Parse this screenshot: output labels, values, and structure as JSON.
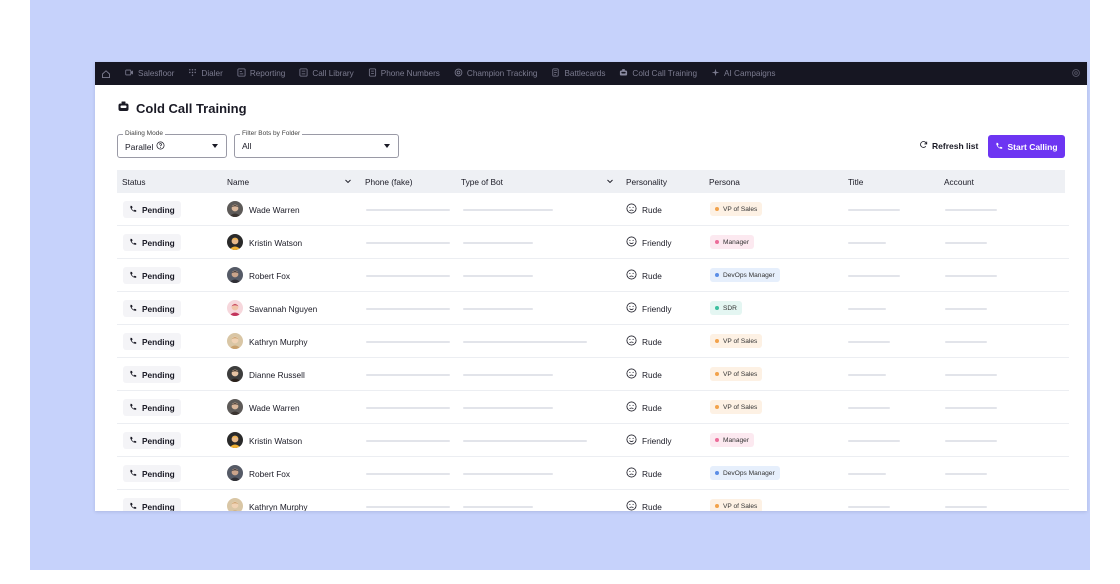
{
  "nav": {
    "items": [
      {
        "label": "Salesfloor",
        "icon": "video-icon"
      },
      {
        "label": "Dialer",
        "icon": "dialpad-icon"
      },
      {
        "label": "Reporting",
        "icon": "report-icon"
      },
      {
        "label": "Call Library",
        "icon": "library-icon"
      },
      {
        "label": "Phone Numbers",
        "icon": "phone-numbers-icon"
      },
      {
        "label": "Champion Tracking",
        "icon": "target-icon"
      },
      {
        "label": "Battlecards",
        "icon": "battlecard-icon"
      },
      {
        "label": "Cold Call Training",
        "icon": "bot-icon"
      },
      {
        "label": "AI Campaigns",
        "icon": "sparkle-icon"
      }
    ]
  },
  "page": {
    "title": "Cold Call Training",
    "title_icon": "bot-icon"
  },
  "filters": {
    "dialing_mode": {
      "legend": "Dialing Mode",
      "value": "Parallel"
    },
    "bot_folder": {
      "legend": "Filter Bots by Folder",
      "value": "All"
    }
  },
  "actions": {
    "refresh_label": "Refresh list",
    "start_label": "Start Calling"
  },
  "colors": {
    "accent": "#6d35f2",
    "nav_bg": "#161622",
    "backdrop": "#c6d2fb"
  },
  "table": {
    "columns": [
      "Status",
      "Name",
      "Phone (fake)",
      "Type of Bot",
      "Personality",
      "Persona",
      "Title",
      "Account"
    ],
    "persona_styles": {
      "VP of Sales": {
        "bg": "#fdf1e4",
        "dot": "#f2a24b"
      },
      "Manager": {
        "bg": "#fce9f0",
        "dot": "#ec6d9a"
      },
      "DevOps Manager": {
        "bg": "#e6effc",
        "dot": "#5b8ee6"
      },
      "SDR": {
        "bg": "#e4f6f2",
        "dot": "#3cbf9f"
      }
    },
    "rows": [
      {
        "status": "Pending",
        "name": "Wade Warren",
        "personality": "Rude",
        "persona": "VP of Sales"
      },
      {
        "status": "Pending",
        "name": "Kristin Watson",
        "personality": "Friendly",
        "persona": "Manager"
      },
      {
        "status": "Pending",
        "name": "Robert Fox",
        "personality": "Rude",
        "persona": "DevOps Manager"
      },
      {
        "status": "Pending",
        "name": "Savannah Nguyen",
        "personality": "Friendly",
        "persona": "SDR"
      },
      {
        "status": "Pending",
        "name": "Kathryn Murphy",
        "personality": "Rude",
        "persona": "VP of Sales"
      },
      {
        "status": "Pending",
        "name": "Dianne Russell",
        "personality": "Rude",
        "persona": "VP of Sales"
      },
      {
        "status": "Pending",
        "name": "Wade Warren",
        "personality": "Rude",
        "persona": "VP of Sales"
      },
      {
        "status": "Pending",
        "name": "Kristin Watson",
        "personality": "Friendly",
        "persona": "Manager"
      },
      {
        "status": "Pending",
        "name": "Robert Fox",
        "personality": "Rude",
        "persona": "DevOps Manager"
      },
      {
        "status": "Pending",
        "name": "Kathryn Murphy",
        "personality": "Rude",
        "persona": "VP of Sales"
      }
    ]
  }
}
